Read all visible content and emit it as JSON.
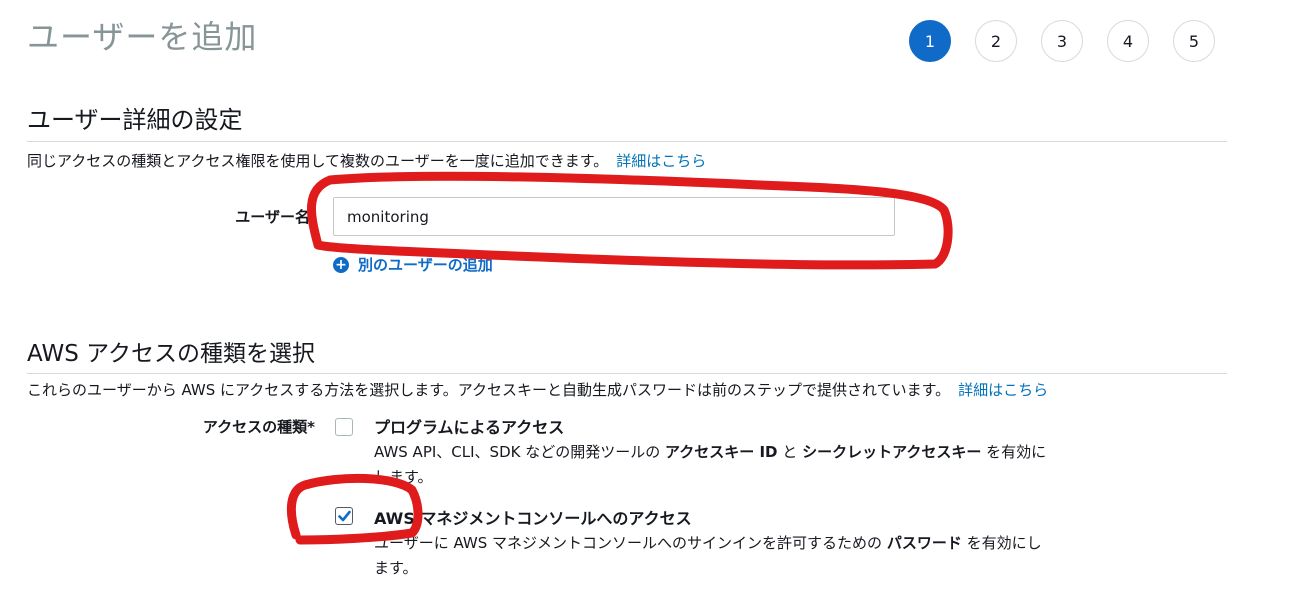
{
  "page": {
    "title": "ユーザーを追加"
  },
  "steps": [
    {
      "label": "1",
      "active": true
    },
    {
      "label": "2",
      "active": false
    },
    {
      "label": "3",
      "active": false
    },
    {
      "label": "4",
      "active": false
    },
    {
      "label": "5",
      "active": false
    }
  ],
  "user_details": {
    "heading": "ユーザー詳細の設定",
    "description": "同じアクセスの種類とアクセス権限を使用して複数のユーザーを一度に追加できます。",
    "learn_more": "詳細はこちら",
    "username_label": "ユーザー名",
    "username_value": "monitoring",
    "add_user_link": "別のユーザーの追加"
  },
  "access_type": {
    "heading": "AWS アクセスの種類を選択",
    "description": "これらのユーザーから AWS にアクセスする方法を選択します。アクセスキーと自動生成パスワードは前のステップで提供されています。",
    "learn_more": "詳細はこちら",
    "field_label": "アクセスの種類*",
    "options": [
      {
        "title": "プログラムによるアクセス",
        "checked": false,
        "desc_parts": [
          "AWS API、CLI、SDK などの開発ツールの ",
          "アクセスキー ID",
          " と ",
          "シークレットアクセスキー",
          " を有効にします。"
        ]
      },
      {
        "title": "AWS マネジメントコンソールへのアクセス",
        "checked": true,
        "desc_parts": [
          "ユーザーに AWS マネジメントコンソールへのサインインを許可するための ",
          "パスワード",
          " を有効にします。"
        ]
      }
    ]
  },
  "colors": {
    "accent": "#0f6bc7",
    "link": "#0073bb",
    "annotation": "#e01b1b"
  }
}
